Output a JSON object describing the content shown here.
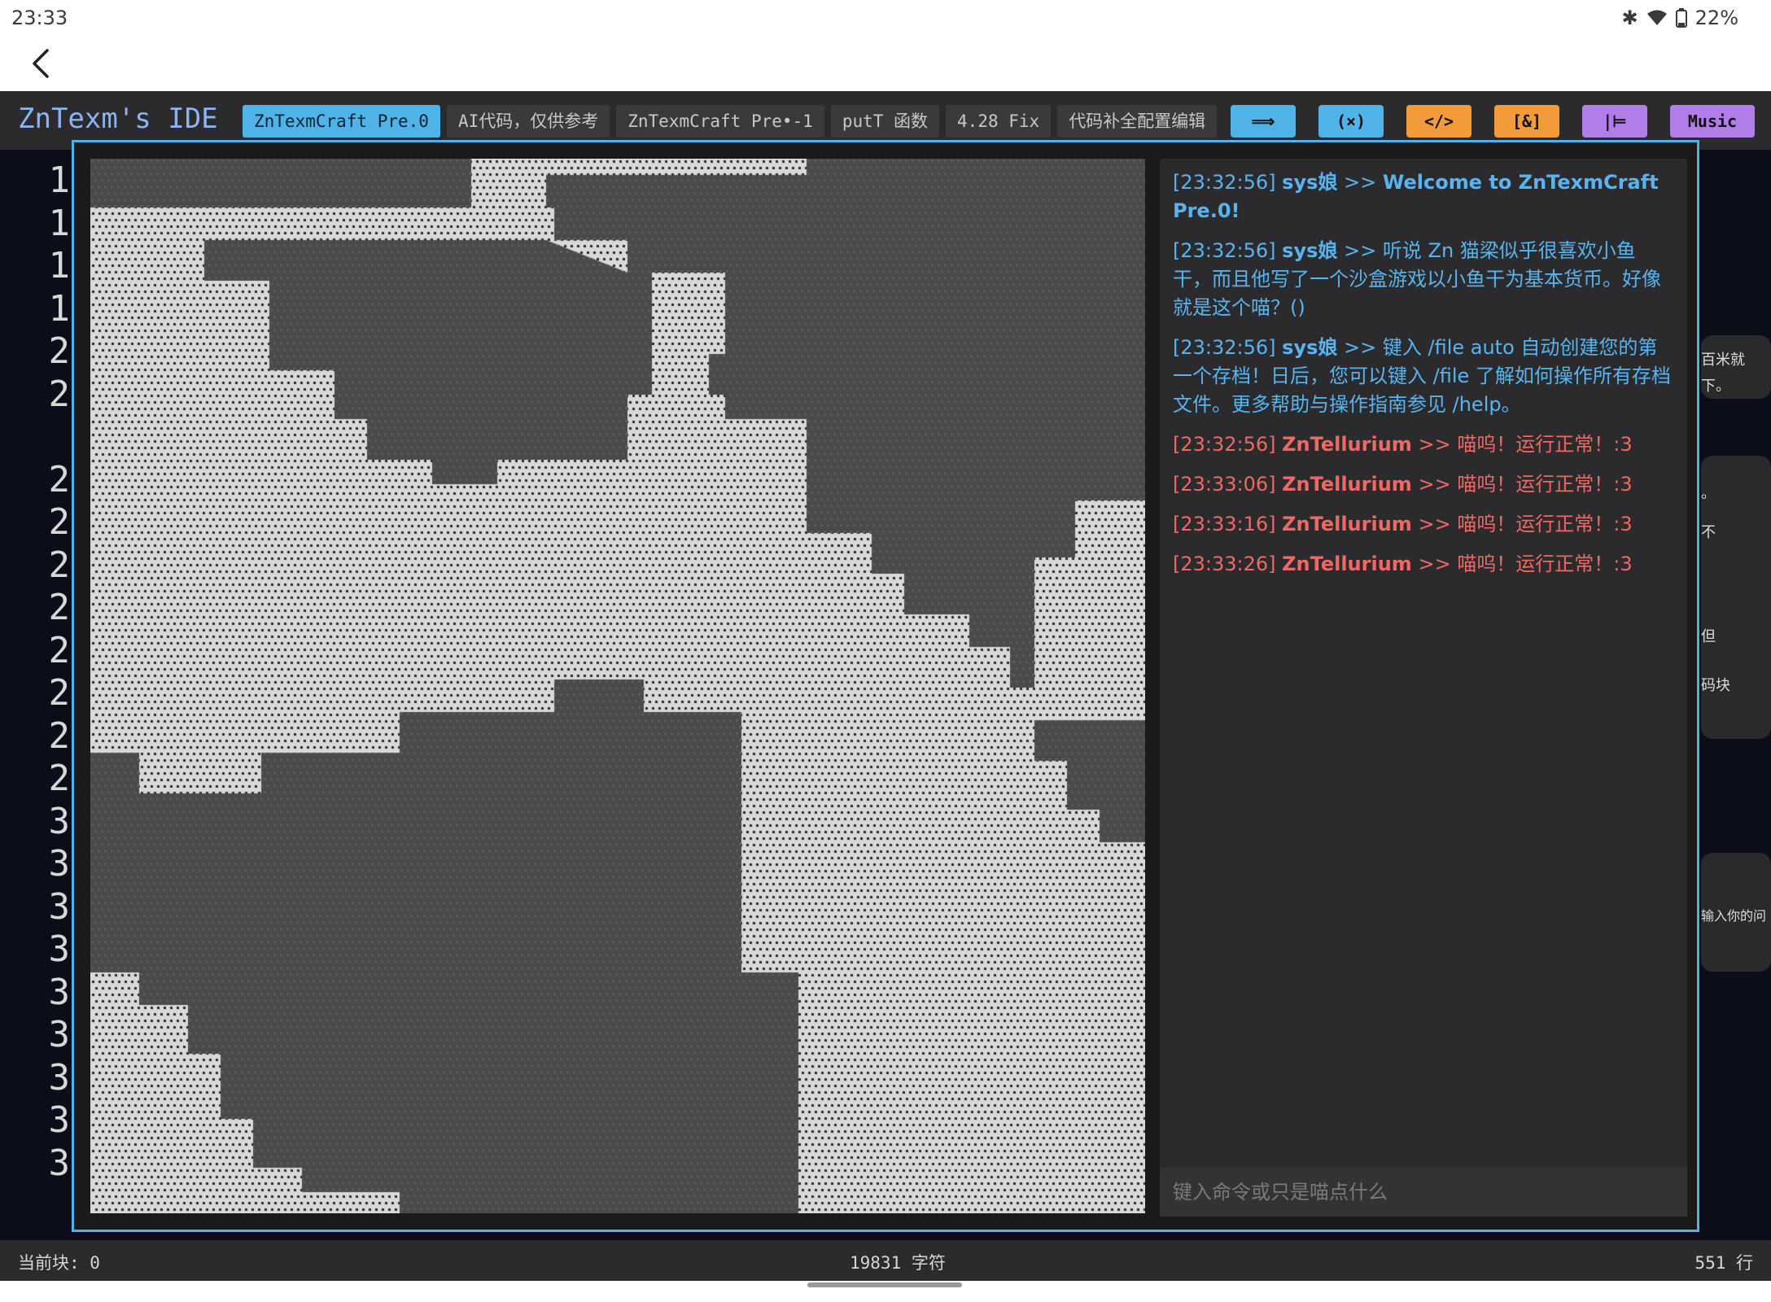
{
  "status_bar": {
    "time": "23:33",
    "battery": "22%"
  },
  "ide": {
    "title": "ZnTexm's IDE",
    "tabs": [
      {
        "label": "ZnTexmCraft Pre.0",
        "active": true
      },
      {
        "label": "AI代码，仅供参考",
        "active": false
      },
      {
        "label": "ZnTexmCraft Pre•-1",
        "active": false
      },
      {
        "label": "putT 函数",
        "active": false
      },
      {
        "label": "4.28 Fix",
        "active": false
      },
      {
        "label": "代码补全配置编辑",
        "active": false
      }
    ],
    "toolbar": [
      {
        "label": "⟹",
        "color": "#4fb3e8",
        "icon": "format-arrow-icon"
      },
      {
        "label": "(×)",
        "color": "#4fb3e8",
        "icon": "variable-icon"
      },
      {
        "label": "</>",
        "color": "#f39a3a",
        "icon": "code-icon"
      },
      {
        "label": "[&]",
        "color": "#f39a3a",
        "icon": "reference-icon"
      },
      {
        "label": "|⊨",
        "color": "#b07ee6",
        "icon": "indent-icon"
      },
      {
        "label": "Music",
        "color": "#b07ee6",
        "icon": "music-icon"
      }
    ],
    "line_numbers": [
      "1",
      "1",
      "1",
      "1",
      "2",
      "2",
      "",
      "2",
      "2",
      "2",
      "2",
      "2",
      "2",
      "2",
      "2",
      "3",
      "3",
      "3",
      "3",
      "3",
      "3",
      "3",
      "3",
      "3"
    ],
    "footer": {
      "current_block": "当前块: 0",
      "char_count": "19831 字符",
      "line_count": "551 行"
    },
    "background_panel": {
      "fragments": [
        "百米就",
        "下。",
        "。",
        "不",
        "但",
        "码块",
        "输入你的问"
      ]
    }
  },
  "game": {
    "map_description_colors": {
      "light_tile": "#d9d9d9",
      "dark_tile": "#4a4a4a"
    },
    "chat": {
      "messages": [
        {
          "time": "[23:32:56]",
          "sender": "sys娘",
          "separator": ">>",
          "text": "Welcome to ZnTexmCraft Pre.0!",
          "type": "sys",
          "bold": true
        },
        {
          "time": "[23:32:56]",
          "sender": "sys娘",
          "separator": ">>",
          "text": "听说 Zn 猫梁似乎很喜欢小鱼干，而且他写了一个沙盒游戏以小鱼干为基本货币。好像就是这个喵？()",
          "type": "sys",
          "bold": false
        },
        {
          "time": "[23:32:56]",
          "sender": "sys娘",
          "separator": ">>",
          "text": "键入 /file auto 自动创建您的第一个存档！日后，您可以键入 /file 了解如何操作所有存档文件。更多帮助与操作指南参见 /help。",
          "type": "sys",
          "bold": false
        },
        {
          "time": "[23:32:56]",
          "sender": "ZnTellurium",
          "separator": ">>",
          "text": "喵呜！运行正常！:3",
          "type": "zn",
          "bold": false
        },
        {
          "time": "[23:33:06]",
          "sender": "ZnTellurium",
          "separator": ">>",
          "text": "喵呜！运行正常！:3",
          "type": "zn",
          "bold": false
        },
        {
          "time": "[23:33:16]",
          "sender": "ZnTellurium",
          "separator": ">>",
          "text": "喵呜！运行正常！:3",
          "type": "zn",
          "bold": false
        },
        {
          "time": "[23:33:26]",
          "sender": "ZnTellurium",
          "separator": ">>",
          "text": "喵呜！运行正常！:3",
          "type": "zn",
          "bold": false
        }
      ],
      "input_placeholder": "键入命令或只是喵点什么"
    }
  }
}
